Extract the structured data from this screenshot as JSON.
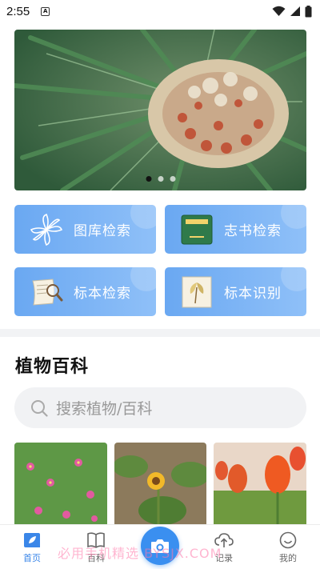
{
  "status_bar": {
    "time": "2:55",
    "notification_badge": "A"
  },
  "banner": {
    "slide_count": 3,
    "active_slide": 1
  },
  "tiles": [
    {
      "label": "图库检索",
      "icon": "pinwheel-icon"
    },
    {
      "label": "志书检索",
      "icon": "book-icon"
    },
    {
      "label": "标本检索",
      "icon": "scroll-magnifier-icon"
    },
    {
      "label": "标本识别",
      "icon": "leaf-specimen-icon"
    }
  ],
  "section": {
    "title": "植物百科"
  },
  "search": {
    "placeholder": "搜索植物/百科"
  },
  "thumbnails": [
    {
      "subject": "pink-flowers"
    },
    {
      "subject": "sunflower"
    },
    {
      "subject": "tulips"
    }
  ],
  "tabbar": {
    "items": [
      {
        "label": "首页",
        "icon": "home-leaf-icon",
        "active": true
      },
      {
        "label": "百科",
        "icon": "open-book-icon",
        "active": false
      },
      {
        "label": "",
        "icon": "camera-icon",
        "active": false
      },
      {
        "label": "记录",
        "icon": "cloud-upload-icon",
        "active": false
      },
      {
        "label": "我的",
        "icon": "smiley-icon",
        "active": false
      }
    ]
  },
  "watermark": "必用手机精选 BYSJX.COM",
  "colors": {
    "accent": "#3a86e8",
    "tile_start": "#6aa8f2",
    "tile_end": "#8fc0f8"
  }
}
